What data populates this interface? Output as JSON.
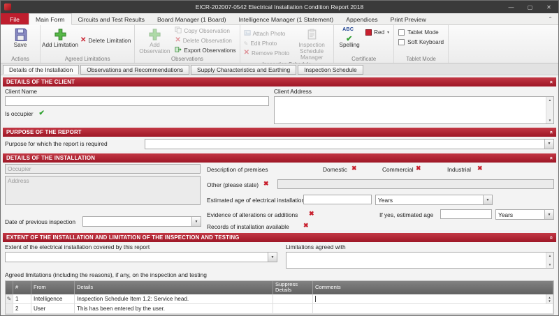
{
  "icons": {
    "minimize": "—",
    "maximize": "▢",
    "close": "✕",
    "pin": "⌃",
    "dropdown": "▼",
    "scroll_up": "▲",
    "scroll_down": "▼",
    "section_collapse": "»",
    "green_check": "✔",
    "red_x": "✖",
    "pencil": "✎",
    "x_small": "✕",
    "abc": "ABC",
    "abc_check": "✔"
  },
  "window": {
    "title": "EICR-202007-0542 Electrical Installation Condition Report 2018"
  },
  "ribbon": {
    "tabs": [
      "File",
      "Main Form",
      "Circuits and Test Results",
      "Board Manager (1 Board)",
      "Intelligence Manager (1 Statement)",
      "Appendices",
      "Print Preview"
    ],
    "groups": {
      "actions": {
        "label": "Actions",
        "save": "Save"
      },
      "agreed_limitations": {
        "label": "Agreed Limitations",
        "add": "Add Limitation",
        "delete": "Delete Limitation"
      },
      "observations": {
        "label": "Observations",
        "add": "Add Observation",
        "copy": "Copy Observation",
        "delete": "Delete Observation",
        "export": "Export Observations"
      },
      "inspection_schedule": {
        "label": "Inspection Schedule",
        "attach": "Attach Photo",
        "edit": "Edit Photo",
        "remove": "Remove Photo",
        "manager": "Inspection Schedule Manager"
      },
      "certificate": {
        "label": "Certificate",
        "spelling": "Spelling",
        "color": "Red"
      },
      "tablet": {
        "label": "Tablet Mode",
        "tablet_mode": "Tablet Mode",
        "soft_keyboard": "Soft Keyboard"
      }
    }
  },
  "doc_tabs": [
    "Details of the Installation",
    "Observations and Recommendations",
    "Supply Characteristics and Earthing",
    "Inspection Schedule"
  ],
  "sections": {
    "client": {
      "header": "DETAILS OF THE CLIENT",
      "client_name_label": "Client Name",
      "client_name_value": "",
      "is_occupier_label": "Is occupier",
      "client_address_label": "Client Address",
      "client_address_value": ""
    },
    "purpose": {
      "header": "PURPOSE OF THE REPORT",
      "label": "Purpose for which the report is required",
      "value": ""
    },
    "installation": {
      "header": "DETAILS OF THE INSTALLATION",
      "occupier_placeholder": "Occupier",
      "address_placeholder": "Address",
      "date_prev_label": "Date of previous inspection",
      "date_prev_value": "",
      "description_label": "Description of premises",
      "domestic_label": "Domestic",
      "commercial_label": "Commercial",
      "industrial_label": "Industrial",
      "other_label": "Other (please state)",
      "other_value": "",
      "estimated_age_label": "Estimated age of electrical installation",
      "estimated_age_value": "",
      "estimated_age_units": "Years",
      "evidence_label": "Evidence of alterations or additions",
      "if_yes_label": "If yes, estimated age",
      "if_yes_value": "",
      "if_yes_units": "Years",
      "records_label": "Records of installation available"
    },
    "extent": {
      "header": "EXTENT OF THE INSTALLATION AND LIMITATION OF THE INSPECTION AND TESTING",
      "extent_label": "Extent of the electrical installation covered by this report",
      "extent_value": "",
      "limitations_label": "Limitations agreed with",
      "limitations_value": "",
      "agreed_label": "Agreed limitations (including the reasons), if any, on the inspection and testing",
      "table": {
        "col_num": "#",
        "col_from": "From",
        "col_details": "Details",
        "col_suppress": "Suppress Details",
        "col_comments": "Comments",
        "rows": [
          {
            "num": "1",
            "from": "Intelligence",
            "details": "Inspection Schedule Item 1.2: Service head.",
            "suppress": "",
            "comments": ""
          },
          {
            "num": "2",
            "from": "User",
            "details": "This has been entered by the user.",
            "suppress": "",
            "comments": ""
          }
        ]
      }
    }
  }
}
